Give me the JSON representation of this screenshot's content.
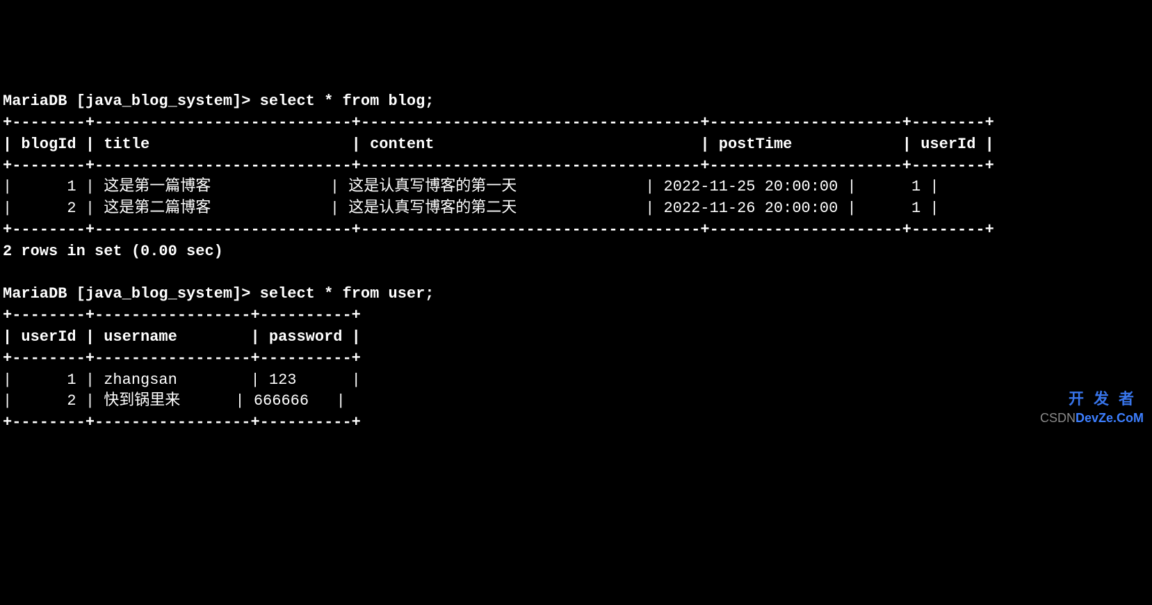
{
  "prompt1": {
    "prefix": "MariaDB [java_blog_system]> ",
    "query": "select * from blog;"
  },
  "table1": {
    "border_top": "+--------+----------------------------+-------------------------------------+---------------------+--------+",
    "header_row": "| blogId | title                      | content                             | postTime            | userId |",
    "border_mid": "+--------+----------------------------+-------------------------------------+---------------------+--------+",
    "row1": "|      1 | 这是第一篇博客             | 这是认真写博客的第一天              | 2022-11-25 20:00:00 |      1 |",
    "row2": "|      2 | 这是第二篇博客             | 这是认真写博客的第二天              | 2022-11-26 20:00:00 |      1 |",
    "border_bot": "+--------+----------------------------+-------------------------------------+---------------------+--------+"
  },
  "result1": "2 rows in set (0.00 sec)",
  "blank": "",
  "prompt2": {
    "prefix": "MariaDB [java_blog_system]> ",
    "query": "select * from user;"
  },
  "table2": {
    "border_top": "+--------+-----------------+----------+",
    "header_row": "| userId | username        | password |",
    "border_mid": "+--------+-----------------+----------+",
    "row1": "|      1 | zhangsan        | 123      |",
    "row2": "|      2 | 快到锅里来      | 666666   |",
    "border_bot": "+--------+-----------------+----------+"
  },
  "chart_data": {
    "type": "table",
    "tables": [
      {
        "query": "select * from blog;",
        "columns": [
          "blogId",
          "title",
          "content",
          "postTime",
          "userId"
        ],
        "rows": [
          [
            1,
            "这是第一篇博客",
            "这是认真写博客的第一天",
            "2022-11-25 20:00:00",
            1
          ],
          [
            2,
            "这是第二篇博客",
            "这是认真写博客的第二天",
            "2022-11-26 20:00:00",
            1
          ]
        ],
        "result_summary": "2 rows in set (0.00 sec)"
      },
      {
        "query": "select * from user;",
        "columns": [
          "userId",
          "username",
          "password"
        ],
        "rows": [
          [
            1,
            "zhangsan",
            "123"
          ],
          [
            2,
            "快到锅里来",
            "666666"
          ]
        ]
      }
    ]
  },
  "watermark": {
    "cn": "开发者",
    "csdn_prefix": "CSDN",
    "brand": "DevZe.CoM"
  }
}
